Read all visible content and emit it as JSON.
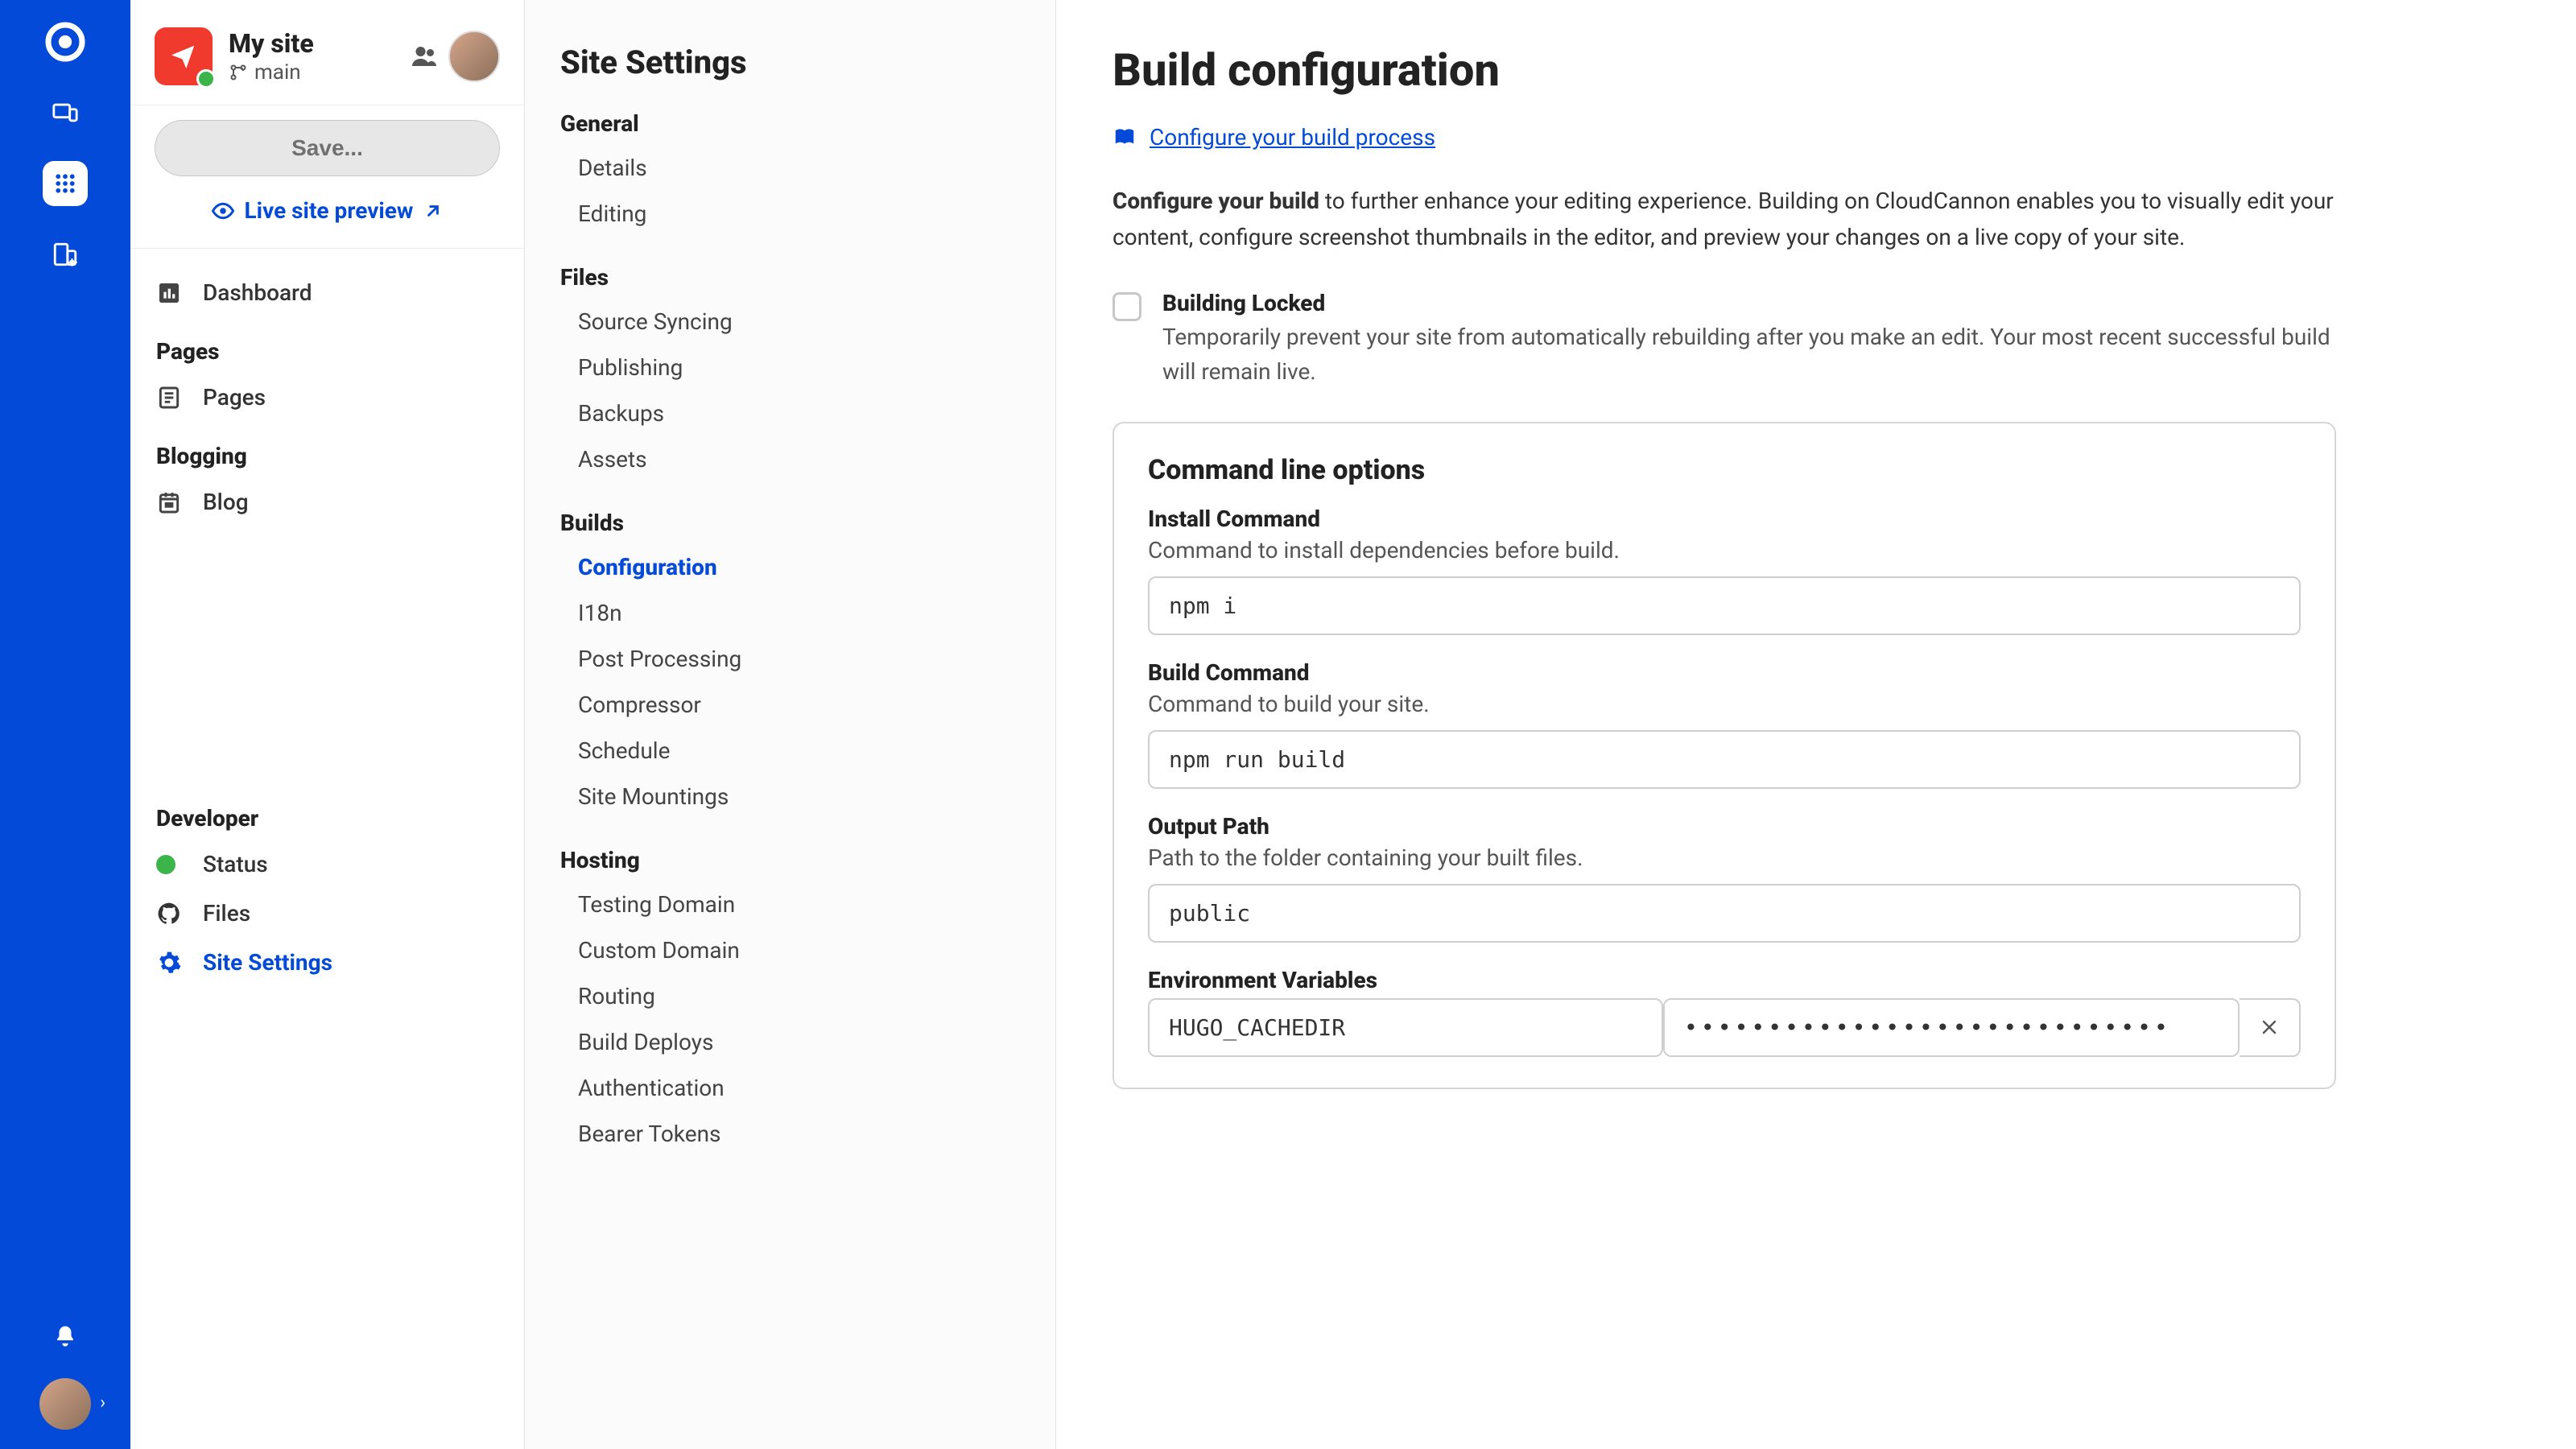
{
  "site": {
    "name": "My site",
    "branch": "main"
  },
  "sidebar": {
    "save_label": "Save...",
    "preview_label": "Live site preview",
    "nav": {
      "dashboard": "Dashboard",
      "pages_heading": "Pages",
      "pages": "Pages",
      "blogging_heading": "Blogging",
      "blog": "Blog",
      "developer_heading": "Developer",
      "status": "Status",
      "files": "Files",
      "site_settings": "Site Settings"
    }
  },
  "settings": {
    "title": "Site Settings",
    "groups": {
      "general": {
        "title": "General",
        "items": {
          "details": "Details",
          "editing": "Editing"
        }
      },
      "files": {
        "title": "Files",
        "items": {
          "source_syncing": "Source Syncing",
          "publishing": "Publishing",
          "backups": "Backups",
          "assets": "Assets"
        }
      },
      "builds": {
        "title": "Builds",
        "items": {
          "configuration": "Configuration",
          "i18n": "I18n",
          "post_processing": "Post Processing",
          "compressor": "Compressor",
          "schedule": "Schedule",
          "site_mountings": "Site Mountings"
        }
      },
      "hosting": {
        "title": "Hosting",
        "items": {
          "testing_domain": "Testing Domain",
          "custom_domain": "Custom Domain",
          "routing": "Routing",
          "build_deploys": "Build Deploys",
          "authentication": "Authentication",
          "bearer_tokens": "Bearer Tokens"
        }
      }
    }
  },
  "page": {
    "title": "Build configuration",
    "doc_link": "Configure your build process",
    "intro_bold": "Configure your build",
    "intro_rest": " to further enhance your editing experience. Building on CloudCannon enables you to visually edit your content, configure screenshot thumbnails in the editor, and preview your changes on a live copy of your site.",
    "lock": {
      "title": "Building Locked",
      "desc": "Temporarily prevent your site from automatically rebuilding after you make an edit. Your most recent successful build will remain live."
    },
    "cli": {
      "title": "Command line options",
      "install": {
        "label": "Install Command",
        "desc": "Command to install dependencies before build.",
        "value": "npm i"
      },
      "build": {
        "label": "Build Command",
        "desc": "Command to build your site.",
        "value": "npm run build"
      },
      "output": {
        "label": "Output Path",
        "desc": "Path to the folder containing your built files.",
        "value": "public"
      },
      "env": {
        "label": "Environment Variables",
        "key": "HUGO_CACHEDIR",
        "value": "•••••••••••••••••••••••••••••"
      }
    }
  }
}
